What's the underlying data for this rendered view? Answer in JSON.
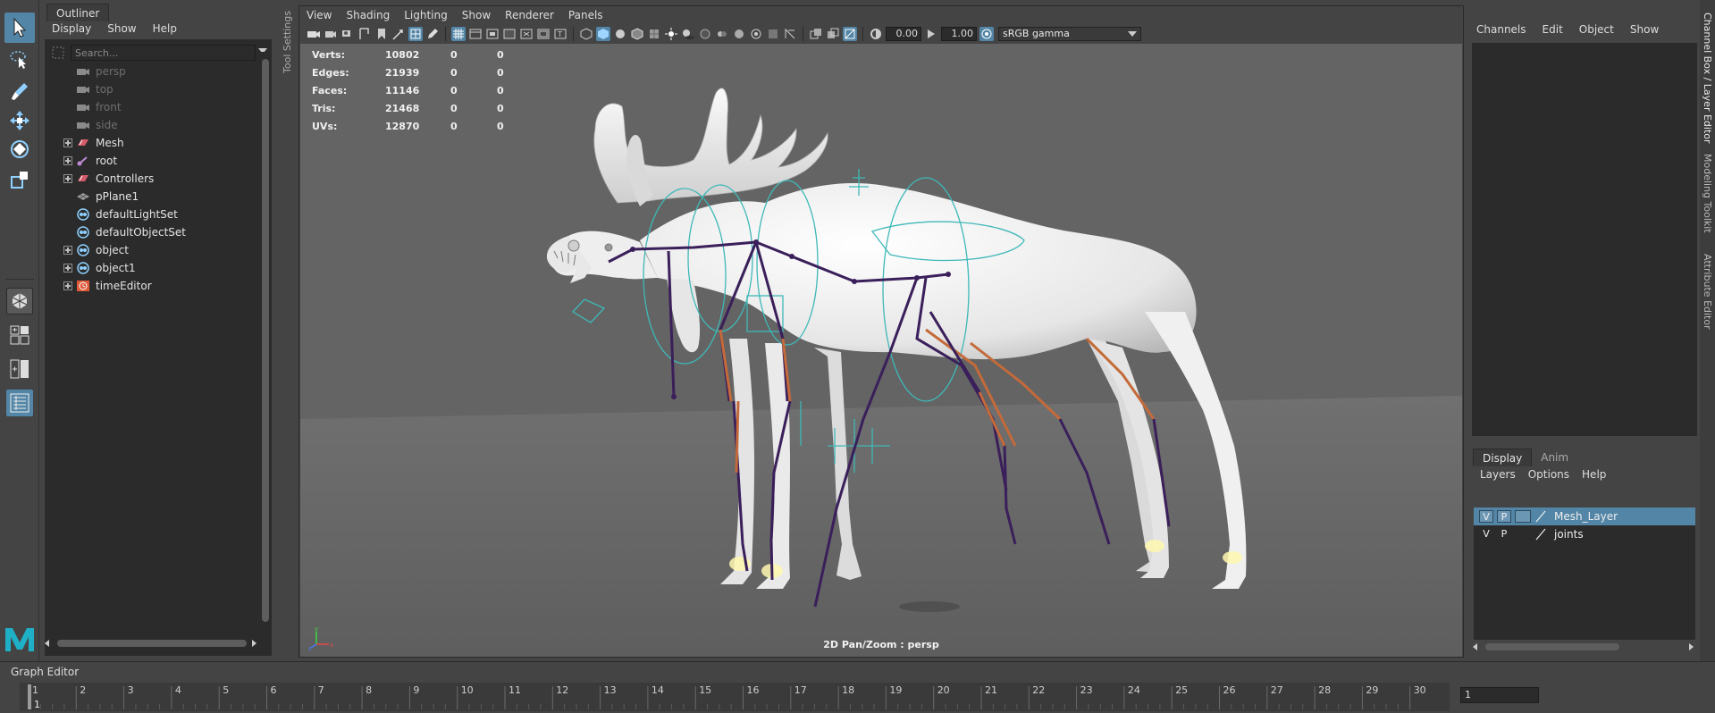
{
  "toolbox": {
    "tools": [
      "select-tool",
      "lasso-tool",
      "paint-select-tool",
      "move-tool",
      "rotate-tool",
      "scale-tool"
    ],
    "layouts": [
      "single-perspective-layout",
      "four-view-layout",
      "two-pane-layout",
      "outliner-persp-layout"
    ]
  },
  "outliner": {
    "tab": "Outliner",
    "menu": [
      "Display",
      "Show",
      "Help"
    ],
    "search_placeholder": "Search...",
    "items": [
      {
        "label": "persp",
        "icon": "camera-icon",
        "expand": false,
        "dim": true
      },
      {
        "label": "top",
        "icon": "camera-icon",
        "expand": false,
        "dim": true
      },
      {
        "label": "front",
        "icon": "camera-icon",
        "expand": false,
        "dim": true
      },
      {
        "label": "side",
        "icon": "camera-icon",
        "expand": false,
        "dim": true
      },
      {
        "label": "Mesh",
        "icon": "group-icon",
        "expand": true,
        "dim": false
      },
      {
        "label": "root",
        "icon": "joint-icon",
        "expand": true,
        "dim": false
      },
      {
        "label": "Controllers",
        "icon": "group-icon",
        "expand": true,
        "dim": false
      },
      {
        "label": "pPlane1",
        "icon": "plane-icon",
        "expand": false,
        "dim": false
      },
      {
        "label": "defaultLightSet",
        "icon": "set-icon",
        "expand": false,
        "dim": false
      },
      {
        "label": "defaultObjectSet",
        "icon": "set-icon",
        "expand": false,
        "dim": false
      },
      {
        "label": "object",
        "icon": "set-icon",
        "expand": true,
        "dim": false
      },
      {
        "label": "object1",
        "icon": "set-icon",
        "expand": true,
        "dim": false
      },
      {
        "label": "timeEditor",
        "icon": "time-editor-icon",
        "expand": true,
        "dim": false
      }
    ]
  },
  "tool_settings_label": "Tool Settings",
  "viewport": {
    "menu": [
      "View",
      "Shading",
      "Lighting",
      "Show",
      "Renderer",
      "Panels"
    ],
    "exposure": "0.00",
    "gamma": "1.00",
    "colorspace": "sRGB gamma",
    "hud": [
      {
        "label": "Verts:",
        "v1": "10802",
        "v2": "0",
        "v3": "0"
      },
      {
        "label": "Edges:",
        "v1": "21939",
        "v2": "0",
        "v3": "0"
      },
      {
        "label": "Faces:",
        "v1": "11146",
        "v2": "0",
        "v3": "0"
      },
      {
        "label": "Tris:",
        "v1": "21468",
        "v2": "0",
        "v3": "0"
      },
      {
        "label": "UVs:",
        "v1": "12870",
        "v2": "0",
        "v3": "0"
      }
    ],
    "camera_label": "2D Pan/Zoom : persp"
  },
  "channel_box": {
    "menu": [
      "Channels",
      "Edit",
      "Object",
      "Show"
    ]
  },
  "layer_editor": {
    "tabs": [
      "Display",
      "Anim"
    ],
    "menu": [
      "Layers",
      "Options",
      "Help"
    ],
    "layers": [
      {
        "v": "V",
        "p": "P",
        "name": "Mesh_Layer",
        "selected": true
      },
      {
        "v": "V",
        "p": "P",
        "name": "joints",
        "selected": false
      }
    ]
  },
  "right_strip": {
    "tabs": [
      "Channel Box / Layer Editor",
      "Modeling Toolkit",
      "Attribute Editor"
    ]
  },
  "graph_editor_label": "Graph Editor",
  "timeline": {
    "start": 1,
    "end": 30,
    "current": 1,
    "current_frame_field": "1"
  },
  "colors": {
    "accent": "#5285a6",
    "panel": "#444444",
    "field": "#2b2b2b",
    "viewport_bg": "#646464",
    "rig_curve": "#3fb8b8",
    "joint_purple": "#3a1f5a",
    "joint_orange": "#c46a3a"
  }
}
